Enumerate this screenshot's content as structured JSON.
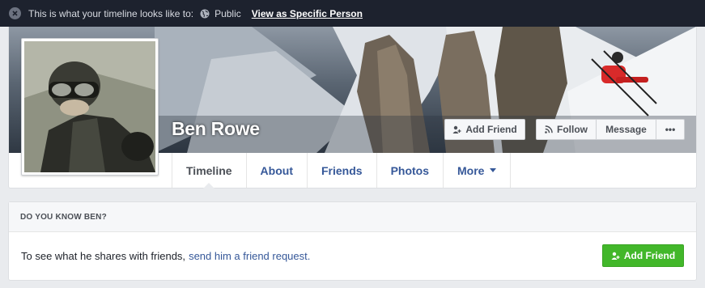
{
  "banner": {
    "text": "This is what your timeline looks like to:",
    "audience": "Public",
    "view_as_link": "View as Specific Person"
  },
  "profile": {
    "name": "Ben Rowe",
    "add_friend_label": "Add Friend",
    "follow_label": "Follow",
    "message_label": "Message",
    "more_label": "•••"
  },
  "tabs": [
    {
      "label": "Timeline"
    },
    {
      "label": "About"
    },
    {
      "label": "Friends"
    },
    {
      "label": "Photos"
    },
    {
      "label": "More"
    }
  ],
  "know": {
    "heading": "DO YOU KNOW BEN?",
    "text": "To see what he shares with friends,",
    "link": "send him a friend request.",
    "button_label": "Add Friend"
  },
  "colors": {
    "banner_bg": "#1d222e",
    "link_blue": "#365899",
    "green": "#42b72a"
  }
}
